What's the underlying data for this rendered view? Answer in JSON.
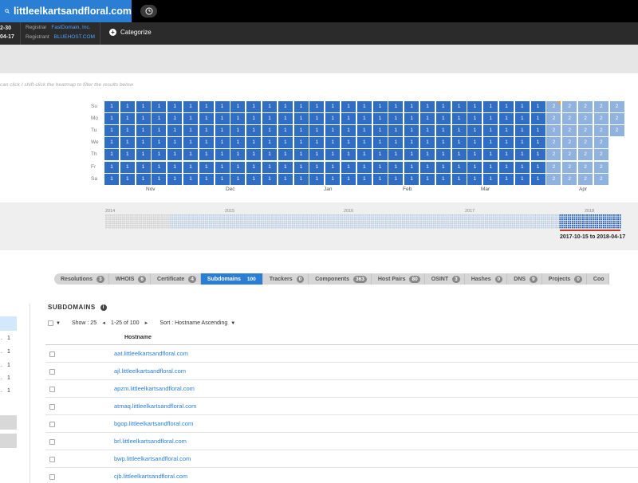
{
  "search": {
    "query": "littleelkartsandfloral.com"
  },
  "info": {
    "dates": [
      "2-30",
      "04-17"
    ],
    "registrar_label": "Registrar",
    "registrar_value": "FastDomain, Inc.",
    "registrant_label": "Registrant",
    "registrant_value": "BLUEHOST.COM",
    "categorize_label": "Categorize"
  },
  "heatmap": {
    "hint": "can click / shift-click the heatmap to filter the results below",
    "day_labels": [
      "Su",
      "Mo",
      "Tu",
      "We",
      "Th",
      "Fr",
      "Sa"
    ],
    "month_labels": [
      "Nov",
      "Dec",
      "Jan",
      "Feb",
      "Mar",
      "Apr"
    ]
  },
  "timeline": {
    "years": [
      "2014",
      "2015",
      "2016",
      "2017",
      "2018"
    ],
    "range": "2017-10-15 to 2018-04-17"
  },
  "tabs": [
    {
      "label": "Resolutions",
      "count": "3"
    },
    {
      "label": "WHOIS",
      "count": "6"
    },
    {
      "label": "Certificate",
      "count": "4"
    },
    {
      "label": "Subdomains",
      "count": "100"
    },
    {
      "label": "Trackers",
      "count": "0"
    },
    {
      "label": "Components",
      "count": "363"
    },
    {
      "label": "Host Pairs",
      "count": "80"
    },
    {
      "label": "OSINT",
      "count": "3"
    },
    {
      "label": "Hashes",
      "count": "0"
    },
    {
      "label": "DNS",
      "count": "9"
    },
    {
      "label": "Projects",
      "count": "0"
    },
    {
      "label": "Coo",
      "count": ""
    }
  ],
  "sidebar": {
    "counts": [
      "1",
      "1",
      "1",
      "1",
      "1"
    ]
  },
  "subdomains": {
    "title": "SUBDOMAINS",
    "show": "Show : 25",
    "page": "1-25 of 100",
    "sort": "Sort : Hostname Ascending",
    "column": "Hostname",
    "rows": [
      "aat.littleelkartsandfloral.com",
      "ajl.littleelkartsandfloral.com",
      "apzm.littleelkartsandfloral.com",
      "atmaq.littleelkartsandfloral.com",
      "bgop.littleelkartsandfloral.com",
      "brl.littleelkartsandfloral.com",
      "bwp.littleelkartsandfloral.com",
      "cjb.littleelkartsandfloral.com"
    ]
  }
}
